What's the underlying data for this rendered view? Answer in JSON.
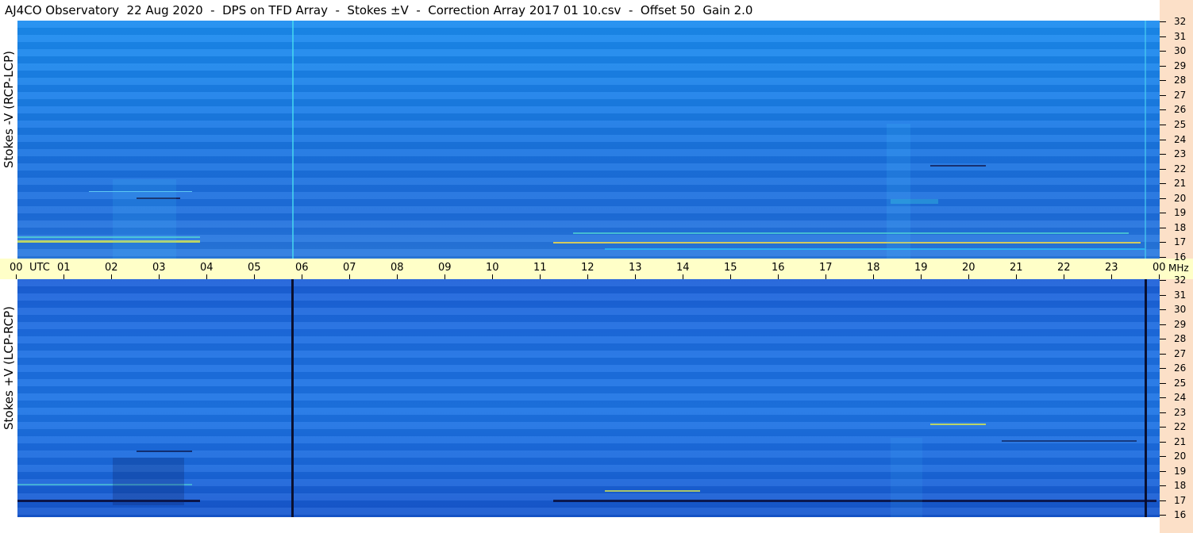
{
  "title": "AJ4CO Observatory  22 Aug 2020  -  DPS on TFD Array  -  Stokes ±V  -  Correction Array 2017 01 10.csv  -  Offset 50  Gain 2.0",
  "panels": {
    "top_label": "Stokes -V (RCP-LCP)",
    "bottom_label": "Stokes +V (LCP-RCP)"
  },
  "utc_unit": "UTC",
  "freq_unit": "MHz",
  "colors": {
    "utc_axis_bg": "#ffffc8",
    "freq_axis_bg": "#fce0c8",
    "spectrogram_blue": "#1a7ee8"
  },
  "chart_data": {
    "type": "heatmap",
    "title": "AJ4CO Observatory  22 Aug 2020  -  DPS on TFD Array  -  Stokes ±V  -  Correction Array 2017 01 10.csv  -  Offset 50  Gain 2.0",
    "x_ticks": [
      "00",
      "01",
      "02",
      "03",
      "04",
      "05",
      "06",
      "07",
      "08",
      "09",
      "10",
      "11",
      "12",
      "13",
      "14",
      "15",
      "16",
      "17",
      "18",
      "19",
      "20",
      "21",
      "22",
      "23",
      "00"
    ],
    "x_unit": "UTC",
    "xlim": [
      0,
      24
    ],
    "y_ticks": [
      32,
      31,
      30,
      29,
      28,
      27,
      26,
      25,
      24,
      23,
      22,
      21,
      20,
      19,
      18,
      17,
      16
    ],
    "y_unit": "MHz",
    "ylim": [
      16,
      32
    ],
    "panels": [
      {
        "name": "Stokes -V (RCP-LCP)"
      },
      {
        "name": "Stokes +V (LCP-RCP)"
      }
    ]
  }
}
